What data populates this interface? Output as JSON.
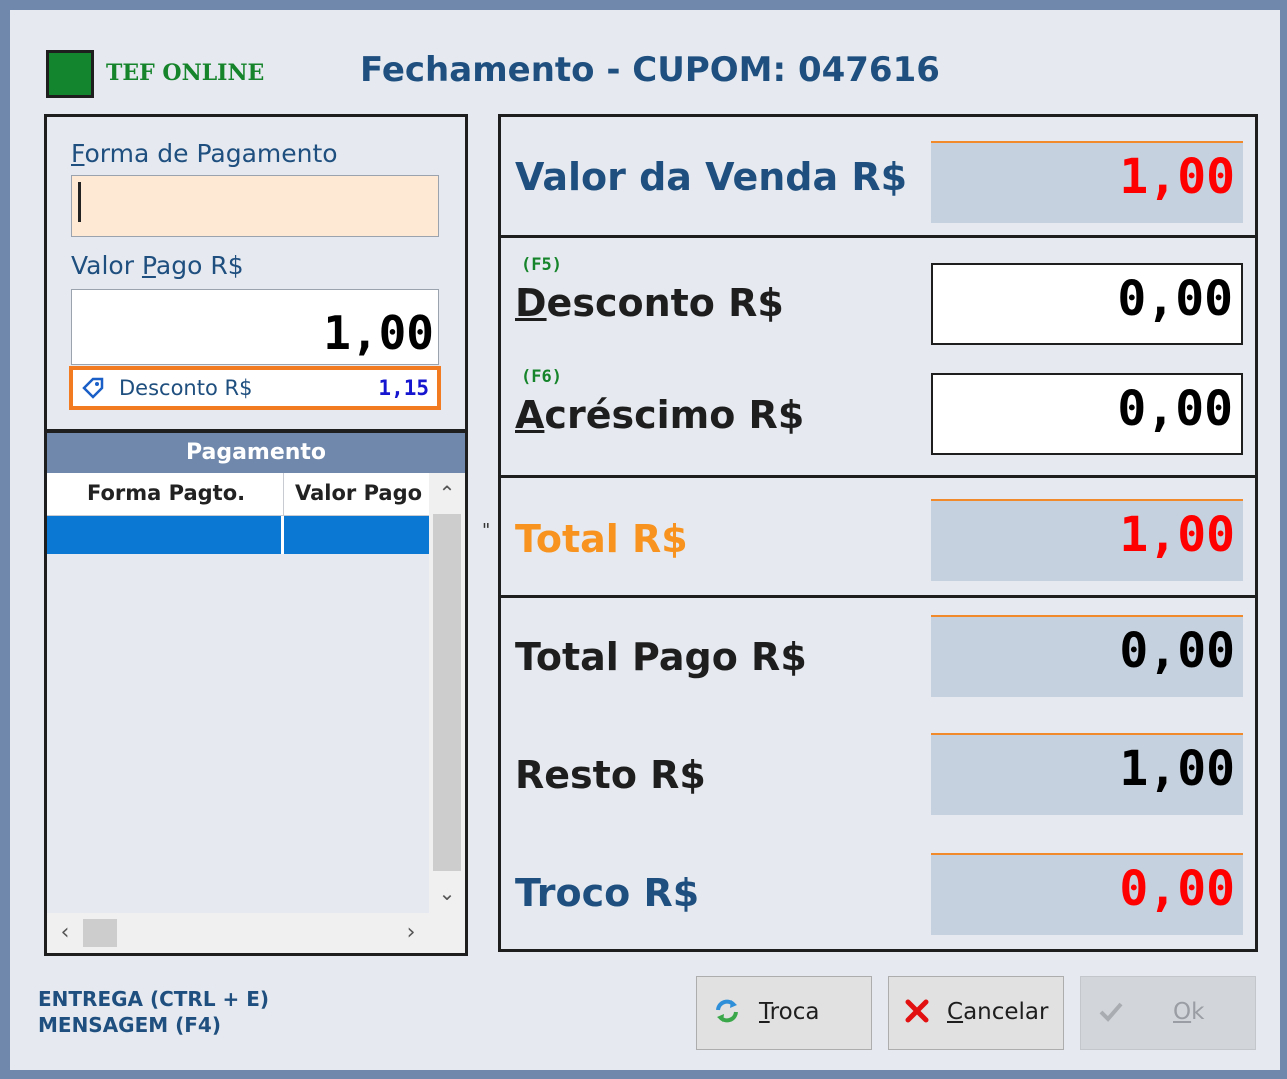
{
  "header": {
    "tef_status": "TEF ONLINE",
    "title": "Fechamento - CUPOM: 047616"
  },
  "left": {
    "forma_label_first": "F",
    "forma_label_rest": "orma de Pagamento",
    "forma_value": "",
    "valor_label_pre": "Valor ",
    "valor_label_u": "P",
    "valor_label_post": "ago R$",
    "valor_value": "1,00",
    "desconto_label": "Desconto R$",
    "desconto_value": "1,15"
  },
  "grid": {
    "title": "Pagamento",
    "columns": [
      "Forma Pagto.",
      "Valor Pago"
    ],
    "rows": [
      [
        "",
        ""
      ]
    ]
  },
  "footer_notes": [
    "ENTREGA (CTRL + E)",
    "MENSAGEM (F4)"
  ],
  "separator_mark": "\"",
  "summary": {
    "venda_label": "Valor da Venda R$",
    "venda_value": "1,00",
    "desconto_fkey": "(F5)",
    "desconto_label_u": "D",
    "desconto_label_rest": "esconto R$",
    "desconto_value": "0,00",
    "acrescimo_fkey": "(F6)",
    "acrescimo_label_u": "A",
    "acrescimo_label_rest": "créscimo R$",
    "acrescimo_value": "0,00",
    "total_label": "Total R$",
    "total_value": "1,00",
    "total_pago_label": "Total Pago R$",
    "total_pago_value": "0,00",
    "resto_label": "Resto R$",
    "resto_value": "1,00",
    "troco_label": "Troco R$",
    "troco_value": "0,00"
  },
  "buttons": {
    "troca_u": "T",
    "troca_rest": "roca",
    "cancelar_u": "C",
    "cancelar_rest": "ancelar",
    "ok_u": "O",
    "ok_rest": "k"
  },
  "colors": {
    "label_blue": "#1f4f7f",
    "value_red": "#ff0000",
    "total_orange": "#f7931e",
    "tef_green": "#16842b",
    "selection_blue": "#0b78d4"
  },
  "icons": {
    "tef": "status-square",
    "desconto": "tag-icon",
    "troca": "refresh-icon",
    "cancelar": "x-icon",
    "ok": "check-icon"
  }
}
